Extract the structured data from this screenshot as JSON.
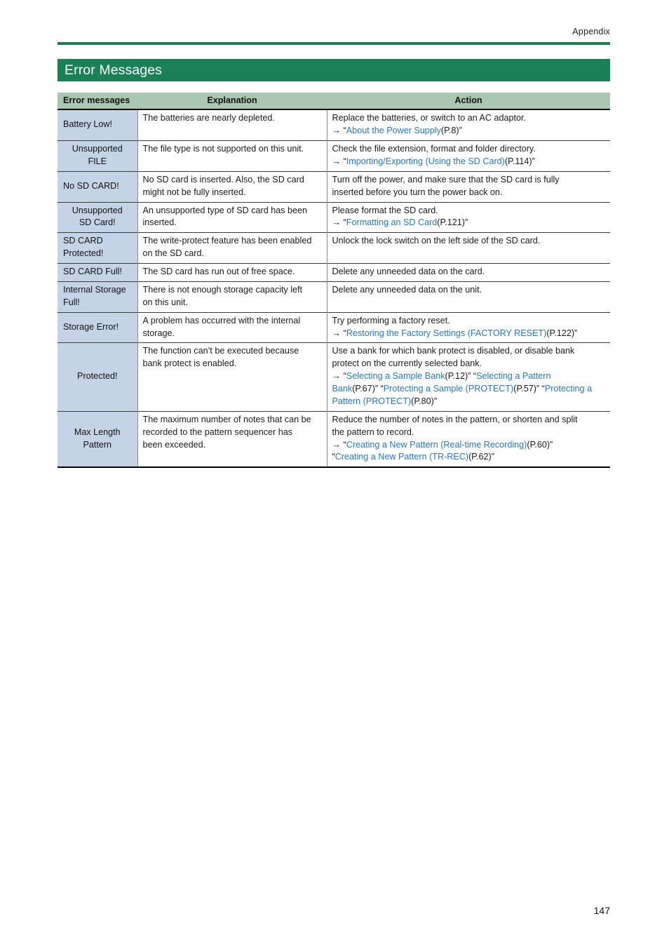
{
  "running_head": "Appendix",
  "section_title": "Error Messages",
  "folio": "147",
  "colors": {
    "banner_green": "#1a8156",
    "rule_green": "#1a7f50",
    "header_row": "#a9c7b2",
    "first_column": "#c5d3e7",
    "link_blue": "#2277cc"
  },
  "table": {
    "headers": {
      "col1": "Error messages",
      "col2": "Explanation",
      "col3": "Action"
    },
    "rows": [
      {
        "message": "Battery Low!",
        "message_align": "left",
        "explanation": [
          "The batteries are nearly depleted."
        ],
        "action_lines": [
          {
            "plain": "Replace the batteries, or switch to an AC adaptor."
          },
          {
            "arrow": "→ “",
            "link": "About the Power Supply",
            "tail": "(P.8)”"
          }
        ]
      },
      {
        "message": "Unsupported\nFILE",
        "message_align": "center",
        "explanation": [
          "The file type is not supported on this unit."
        ],
        "action_lines": [
          {
            "plain": "Check the file extension, format and folder directory."
          },
          {
            "arrow": "→ “",
            "link": "Importing/Exporting (Using the SD Card)",
            "tail": "(P.114)”"
          }
        ]
      },
      {
        "message": "No SD CARD!",
        "message_align": "left",
        "explanation": [
          "No SD card is inserted. Also, the SD card",
          "might not be fully inserted."
        ],
        "action_lines": [
          {
            "plain": "Turn off the power, and make sure that the SD card is fully"
          },
          {
            "plain": "inserted before you turn the power back on."
          }
        ]
      },
      {
        "message": "Unsupported\nSD Card!",
        "message_align": "center",
        "explanation": [
          "An unsupported type of SD card has been",
          "inserted."
        ],
        "action_lines": [
          {
            "plain": "Please format the SD card."
          },
          {
            "arrow": "→ “",
            "link": "Formatting an SD Card",
            "tail": "(P.121)”"
          }
        ]
      },
      {
        "message": "SD CARD\nProtected!",
        "message_align": "left",
        "explanation": [
          "The write-protect feature has been enabled",
          "on the SD card."
        ],
        "action_lines": [
          {
            "plain": "Unlock the lock switch on the left side of the SD card."
          }
        ]
      },
      {
        "message": "SD CARD Full!",
        "message_align": "left",
        "explanation": [
          "The SD card has run out of free space."
        ],
        "action_lines": [
          {
            "plain": "Delete any unneeded data on the card."
          }
        ]
      },
      {
        "message": "Internal Storage\nFull!",
        "message_align": "left",
        "explanation": [
          "There is not enough storage capacity left",
          "on this unit."
        ],
        "action_lines": [
          {
            "plain": "Delete any unneeded data on the unit."
          }
        ]
      },
      {
        "message": "Storage Error!",
        "message_align": "left",
        "explanation": [
          "A problem has occurred with the internal",
          "storage."
        ],
        "action_lines": [
          {
            "plain": "Try performing a factory reset."
          },
          {
            "arrow": "→ “",
            "link": "Restoring the Factory Settings (FACTORY RESET)",
            "tail": "(P.122)”"
          }
        ]
      },
      {
        "message": "Protected!",
        "message_align": "center",
        "explanation": [
          "The function can’t be executed because",
          "bank protect is enabled."
        ],
        "action_lines": [
          {
            "plain": "Use a bank for which bank protect is disabled, or disable bank"
          },
          {
            "plain": "protect on the currently selected bank."
          },
          {
            "arrow": "→ “",
            "link": "Selecting a Sample Bank",
            "tail": "(P.12)” “",
            "link2": "Selecting a Pattern"
          },
          {
            "link": "Bank",
            "tail": "(P.67)” “",
            "link2": "Protecting a Sample (PROTECT)",
            "tail2": "(P.57)” “",
            "link3": "Protecting a"
          },
          {
            "link": "Pattern (PROTECT)",
            "tail": "(P.80)”"
          }
        ]
      },
      {
        "message": "Max Length\nPattern",
        "message_align": "center",
        "explanation": [
          "The maximum number of notes that can be",
          "recorded to the pattern sequencer has",
          "been exceeded."
        ],
        "action_lines": [
          {
            "plain": "Reduce the number of notes in the pattern, or shorten and split"
          },
          {
            "plain": "the pattern to record."
          },
          {
            "arrow": "→ “",
            "link": "Creating a New Pattern (Real-time Recording)",
            "tail": "(P.60)”"
          },
          {
            "arrow": "“",
            "link": "Creating a New Pattern (TR-REC)",
            "tail": "(P.62)”"
          }
        ]
      }
    ]
  }
}
